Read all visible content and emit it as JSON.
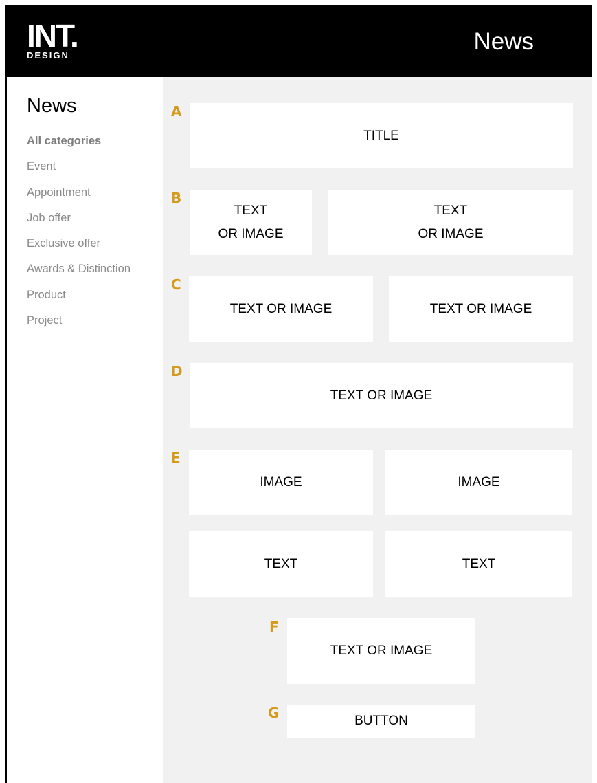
{
  "header": {
    "logo_main": "INT.",
    "logo_sub": "DESIGN",
    "title": "News"
  },
  "sidebar": {
    "title": "News",
    "items": [
      {
        "label": "All categories",
        "active": true
      },
      {
        "label": "Event"
      },
      {
        "label": "Appointment"
      },
      {
        "label": "Job offer"
      },
      {
        "label": "Exclusive offer"
      },
      {
        "label": "Awards & Distinction"
      },
      {
        "label": "Product"
      },
      {
        "label": "Project"
      }
    ]
  },
  "layout_rows": {
    "accent_color": "#d49a1c",
    "A": {
      "label": "A",
      "block": "TITLE"
    },
    "B": {
      "label": "B",
      "blocks": [
        "TEXT\nOR IMAGE",
        "TEXT\nOR IMAGE"
      ]
    },
    "C": {
      "label": "C",
      "blocks": [
        "TEXT OR IMAGE",
        "TEXT OR IMAGE"
      ]
    },
    "D": {
      "label": "D",
      "block": "TEXT OR IMAGE"
    },
    "E": {
      "label": "E",
      "images": [
        "IMAGE",
        "IMAGE"
      ],
      "texts": [
        "TEXT",
        "TEXT"
      ]
    },
    "F": {
      "label": "F",
      "block": "TEXT OR IMAGE"
    },
    "G": {
      "label": "G",
      "block": "BUTTON"
    }
  }
}
